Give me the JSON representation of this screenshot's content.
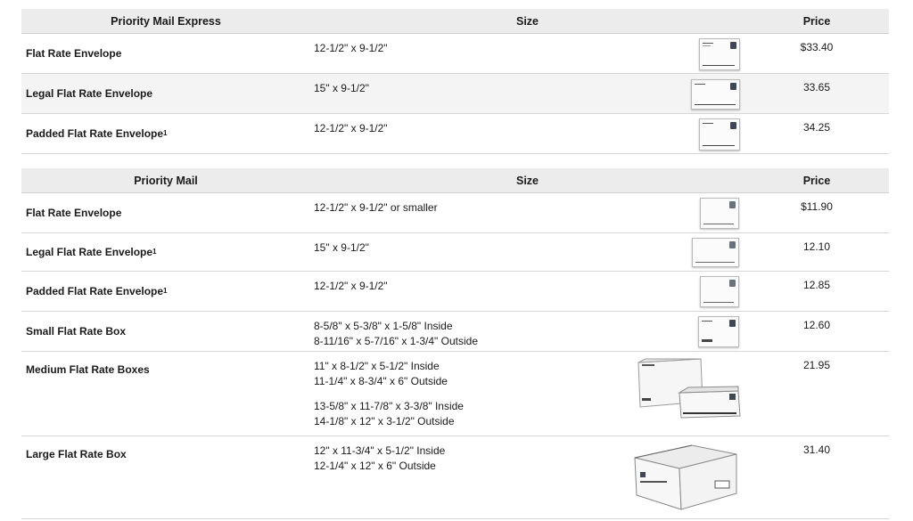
{
  "express": {
    "header": {
      "name": "Priority Mail Express",
      "size": "Size",
      "price": "Price"
    },
    "rows": [
      {
        "name": "Flat Rate Envelope",
        "sup": "",
        "size1": "12-1/2\" x 9-1/2\"",
        "size2": "",
        "price": "$33.40",
        "icon": "envelope-icon"
      },
      {
        "name": "Legal Flat Rate Envelope",
        "sup": "",
        "size1": "15\" x 9-1/2\"",
        "size2": "",
        "price": "33.65",
        "icon": "envelope-icon"
      },
      {
        "name": "Padded Flat Rate Envelope",
        "sup": "1",
        "size1": "12-1/2\" x 9-1/2\"",
        "size2": "",
        "price": "34.25",
        "icon": "envelope-icon"
      }
    ]
  },
  "priority": {
    "header": {
      "name": "Priority Mail",
      "size": "Size",
      "price": "Price"
    },
    "rows": [
      {
        "name": "Flat Rate Envelope",
        "sup": "",
        "size1": "12-1/2\" x 9-1/2\" or smaller",
        "size2": "",
        "price": "$11.90",
        "icon": "envelope-icon"
      },
      {
        "name": "Legal Flat Rate Envelope",
        "sup": "1",
        "size1": "15\" x 9-1/2\"",
        "size2": "",
        "price": "12.10",
        "icon": "envelope-icon"
      },
      {
        "name": "Padded Flat Rate Envelope",
        "sup": "1",
        "size1": "12-1/2\" x 9-1/2\"",
        "size2": "",
        "price": "12.85",
        "icon": "envelope-icon"
      },
      {
        "name": "Small Flat Rate Box",
        "sup": "",
        "size1": "8-5/8\" x 5-3/8\" x 1-5/8\" Inside",
        "size2": "8-11/16\" x 5-7/16\" x 1-3/4\" Outside",
        "price": "12.60",
        "icon": "box-icon"
      },
      {
        "name": "Medium Flat Rate Boxes",
        "sup": "",
        "size1": "11\" x 8-1/2\" x 5-1/2\" Inside",
        "size2": "11-1/4\" x 8-3/4\" x 6\" Outside",
        "size3": "13-5/8\" x 11-7/8\" x 3-3/8\" Inside",
        "size4": "14-1/8\" x 12\" x 3-1/2\" Outside",
        "price": "21.95",
        "icon": "box-icon"
      },
      {
        "name": "Large Flat Rate Box",
        "sup": "",
        "size1": "12\" x 11-3/4\" x 5-1/2\" Inside",
        "size2": "12-1/4\" x 12\" x 6\" Outside",
        "price": "31.40",
        "icon": "box-icon"
      }
    ]
  }
}
